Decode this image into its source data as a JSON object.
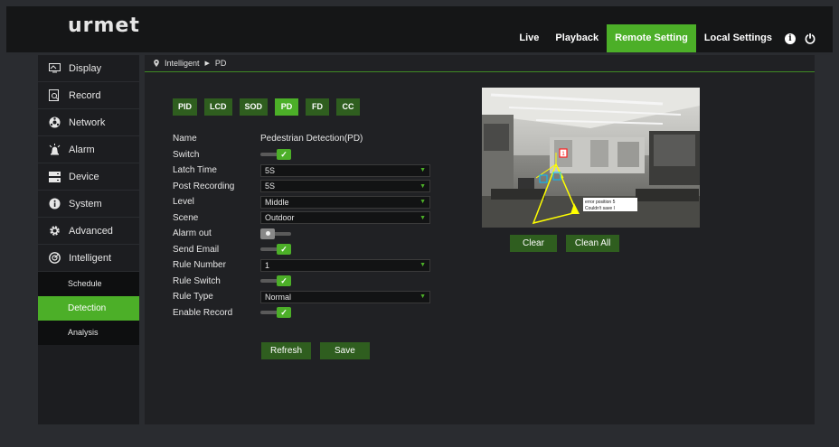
{
  "header": {
    "logo": "urmet",
    "nav": [
      {
        "label": "Live",
        "active": false
      },
      {
        "label": "Playback",
        "active": false
      },
      {
        "label": "Remote Setting",
        "active": true
      },
      {
        "label": "Local Settings",
        "active": false
      }
    ],
    "icons": [
      "info-icon",
      "power-icon"
    ]
  },
  "sidebar": {
    "items": [
      {
        "label": "Display",
        "icon": "monitor-icon"
      },
      {
        "label": "Record",
        "icon": "record-icon"
      },
      {
        "label": "Network",
        "icon": "network-icon"
      },
      {
        "label": "Alarm",
        "icon": "alarm-icon"
      },
      {
        "label": "Device",
        "icon": "device-icon"
      },
      {
        "label": "System",
        "icon": "system-info-icon"
      },
      {
        "label": "Advanced",
        "icon": "gear-icon"
      },
      {
        "label": "Intelligent",
        "icon": "intelligent-icon"
      }
    ],
    "sub_items": [
      {
        "label": "Schedule",
        "active": false
      },
      {
        "label": "Detection",
        "active": true
      },
      {
        "label": "Analysis",
        "active": false
      }
    ]
  },
  "breadcrumb": {
    "parent": "Intelligent",
    "current": "PD"
  },
  "tabs": [
    {
      "label": "PID",
      "active": false
    },
    {
      "label": "LCD",
      "active": false
    },
    {
      "label": "SOD",
      "active": false
    },
    {
      "label": "PD",
      "active": true
    },
    {
      "label": "FD",
      "active": false
    },
    {
      "label": "CC",
      "active": false
    }
  ],
  "form": {
    "name_label": "Name",
    "name_value": "Pedestrian Detection(PD)",
    "switch_label": "Switch",
    "switch_on": true,
    "latch_label": "Latch Time",
    "latch_value": "5S",
    "post_label": "Post Recording",
    "post_value": "5S",
    "level_label": "Level",
    "level_value": "Middle",
    "scene_label": "Scene",
    "scene_value": "Outdoor",
    "alarm_label": "Alarm out",
    "alarm_on": false,
    "email_label": "Send Email",
    "email_on": true,
    "rule_num_label": "Rule Number",
    "rule_num_value": "1",
    "rule_switch_label": "Rule Switch",
    "rule_switch_on": true,
    "rule_type_label": "Rule Type",
    "rule_type_value": "Normal",
    "record_label": "Enable Record",
    "record_on": true,
    "refresh_label": "Refresh",
    "save_label": "Save"
  },
  "preview": {
    "marker_label": "1",
    "overlay_line1": "error position 5",
    "overlay_line2": "Couldn't save I",
    "clear_label": "Clear",
    "clean_all_label": "Clean All"
  },
  "colors": {
    "accent": "#4caf28",
    "accent_dark": "#2f5e1f",
    "background": "#2a2c30",
    "panel": "#202124"
  }
}
